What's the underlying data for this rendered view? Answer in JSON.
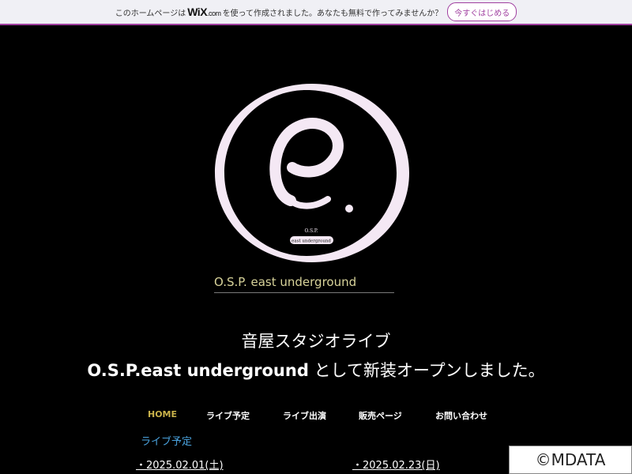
{
  "wix_banner": {
    "text_before": "このホームページは",
    "logo": "WiX",
    "logo_suffix": ".com",
    "text_after": "を使って作成されました。あなたも無料で作ってみませんか？",
    "cta_label": "今すぐはじめる"
  },
  "logo": {
    "letter": "e",
    "small_text": "O.S.P.",
    "pill_text": "east underground"
  },
  "site_name": "O.S.P. east underground",
  "headline": {
    "line1": "音屋スタジオライブ",
    "line2_en": "O.S.P.east underground",
    "line2_jp": " として新装オープンしました。"
  },
  "nav": [
    {
      "label": "HOME",
      "active": true
    },
    {
      "label": "ライブ予定",
      "active": false
    },
    {
      "label": "ライブ出演",
      "active": false
    },
    {
      "label": "販売ページ",
      "active": false
    },
    {
      "label": "お問い合わせ",
      "active": false
    }
  ],
  "section_title": "ライブ予定",
  "dates": [
    "・2025.02.01(土)",
    "・2025.02.23(日)"
  ],
  "watermark": "©MDATA",
  "colors": {
    "background": "#000000",
    "accent": "#a03fa0",
    "nav_active": "#c9b24a",
    "section_title": "#4aa3df",
    "logo_ring": "#f4e8f4"
  }
}
